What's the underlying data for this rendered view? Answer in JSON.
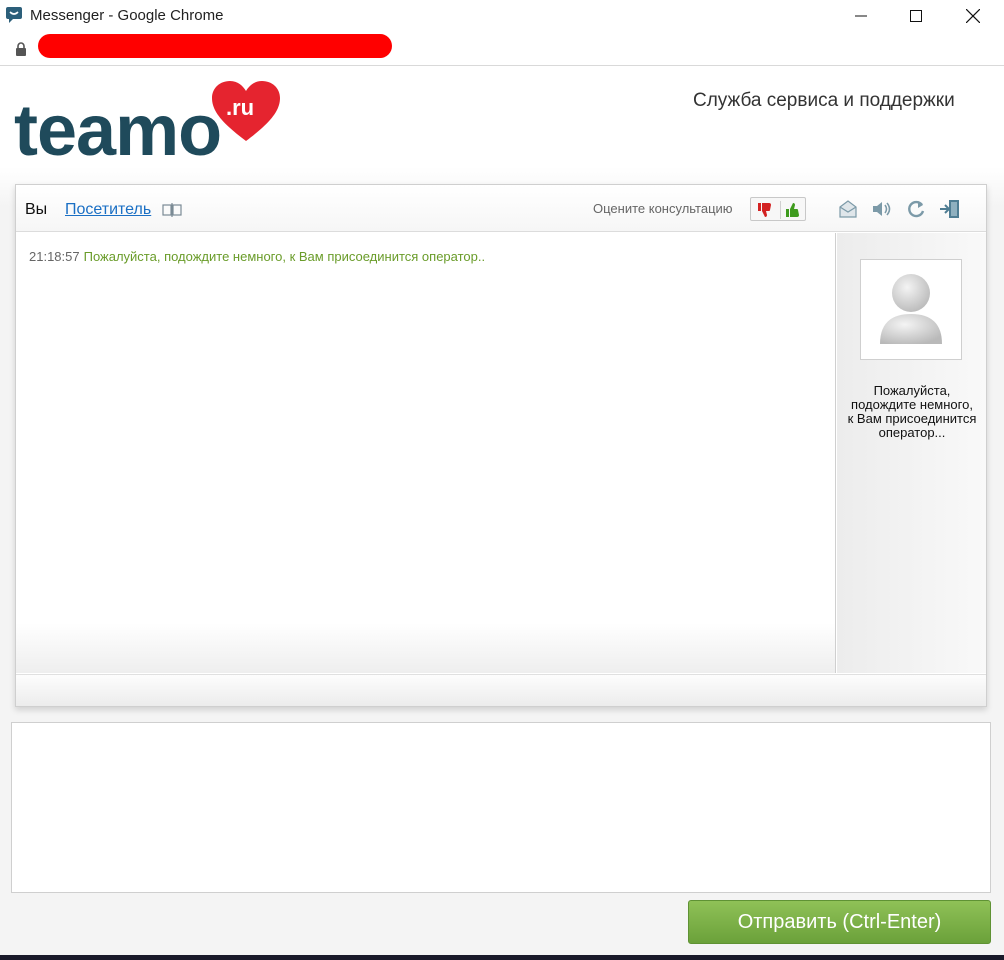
{
  "window": {
    "title": "Messenger - Google Chrome",
    "app_icon": "messenger-icon",
    "controls": [
      "minimize-icon",
      "maximize-icon",
      "close-icon"
    ]
  },
  "addressbar": {
    "lock_icon": "lock-icon",
    "url": ""
  },
  "header": {
    "logo_text": "teamo",
    "logo_suffix": ".ru",
    "support_title": "Служба сервиса и поддержки"
  },
  "chat": {
    "tabs": {
      "you": "Вы",
      "visitor": "Посетитель"
    },
    "rate_label": "Оцените консультацию",
    "rate_buttons": [
      "thumbs-down-icon",
      "thumbs-up-icon"
    ],
    "tools": [
      "email-icon",
      "sound-icon",
      "refresh-icon",
      "exit-icon"
    ],
    "messages": [
      {
        "time": "21:18:57",
        "text": "Пожалуйста, подождите немного, к Вам присоединится оператор.."
      }
    ],
    "operator_status": "Пожалуйста, подождите немного, к Вам присоединится оператор..."
  },
  "input": {
    "value": "",
    "placeholder": ""
  },
  "send_button": "Отправить (Ctrl-Enter)",
  "colors": {
    "logo_dark": "#1f4a5b",
    "heart_red": "#e5242f",
    "message_green": "#6a9c2a",
    "link_blue": "#1a6fc4",
    "send_green": "#7cb247"
  }
}
